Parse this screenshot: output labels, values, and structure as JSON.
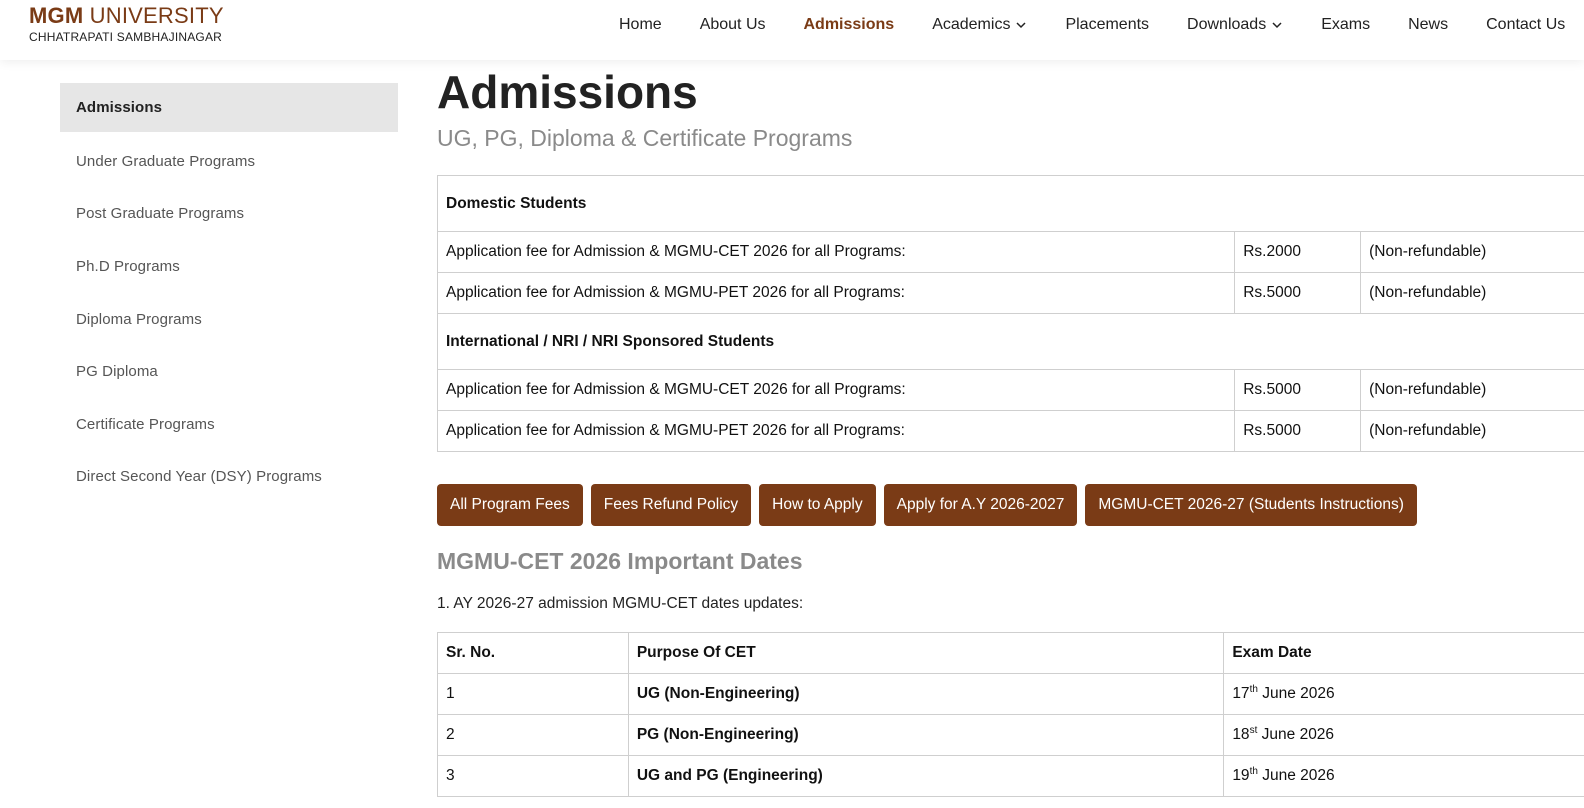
{
  "header": {
    "logo_bold": "MGM",
    "logo_rest": " UNIVERSITY",
    "logo_sub": "CHHATRAPATI SAMBHAJINAGAR",
    "nav": [
      {
        "label": "Home"
      },
      {
        "label": "About Us"
      },
      {
        "label": "Admissions"
      },
      {
        "label": "Academics"
      },
      {
        "label": "Placements"
      },
      {
        "label": "Downloads"
      },
      {
        "label": "Exams"
      },
      {
        "label": "News"
      },
      {
        "label": "Contact Us"
      }
    ]
  },
  "sidebar": {
    "items": [
      {
        "label": "Admissions"
      },
      {
        "label": "Under Graduate Programs"
      },
      {
        "label": "Post Graduate Programs"
      },
      {
        "label": "Ph.D Programs"
      },
      {
        "label": "Diploma Programs"
      },
      {
        "label": "PG Diploma"
      },
      {
        "label": "Certificate Programs"
      },
      {
        "label": "Direct Second Year (DSY) Programs"
      }
    ]
  },
  "main": {
    "title": "Admissions",
    "subtitle": "UG, PG, Diploma & Certificate Programs",
    "fees": {
      "domestic_heading": "Domestic Students",
      "domestic_rows": [
        {
          "label": "Application fee for Admission & MGMU-CET 2026 for all Programs:",
          "amount": "Rs.2000",
          "note": "(Non-refundable)"
        },
        {
          "label": "Application fee for Admission & MGMU-PET 2026 for all Programs:",
          "amount": "Rs.5000",
          "note": "(Non-refundable)"
        }
      ],
      "intl_heading": "International / NRI / NRI Sponsored Students",
      "intl_rows": [
        {
          "label": "Application fee for Admission & MGMU-CET 2026 for all Programs:",
          "amount": "Rs.5000",
          "note": "(Non-refundable)"
        },
        {
          "label": "Application fee for Admission & MGMU-PET 2026 for all Programs:",
          "amount": "Rs.5000",
          "note": "(Non-refundable)"
        }
      ]
    },
    "buttons": [
      {
        "label": "All Program Fees"
      },
      {
        "label": "Fees Refund Policy"
      },
      {
        "label": "How to Apply"
      },
      {
        "label": "Apply for A.Y 2026-2027"
      },
      {
        "label": "MGMU-CET 2026-27 (Students Instructions)"
      }
    ],
    "dates_title": "MGMU-CET 2026 Important Dates",
    "dates_note": "1. AY 2026-27 admission MGMU-CET dates updates:",
    "cet_table": {
      "headers": [
        "Sr. No.",
        "Purpose Of CET",
        "Exam Date"
      ],
      "rows": [
        {
          "sr": "1",
          "purpose": "UG (Non-Engineering)",
          "day": "17",
          "suffix": "th",
          "rest": " June 2026"
        },
        {
          "sr": "2",
          "purpose": "PG (Non-Engineering)",
          "day": "18",
          "suffix": "st",
          "rest": " June 2026"
        },
        {
          "sr": "3",
          "purpose": "UG and PG (Engineering)",
          "day": "19",
          "suffix": "th",
          "rest": " June 2026"
        }
      ]
    }
  },
  "colors": {
    "brand": "#7a3b16",
    "sidebar_active_bg": "#e6e6e6",
    "muted_text": "#8a8a8a"
  }
}
